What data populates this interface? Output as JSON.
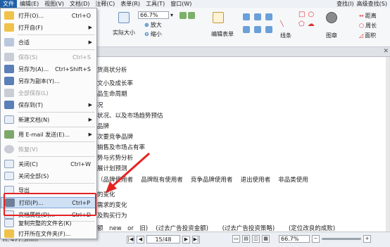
{
  "menubar": {
    "items": [
      "文件",
      "编辑(E)",
      "视图(V)",
      "文档(D)",
      "注释(C)",
      "表单(R)",
      "工具(T)",
      "窗口(W)"
    ],
    "right_items": [
      "查找(I)",
      "高级查找(S)"
    ]
  },
  "ribbon": {
    "zoom_value": "66.7%",
    "actual_size": "实际大小",
    "zoom_in": "放大",
    "zoom_out": "缩小",
    "edit_form": "编辑表单",
    "lines": "线条",
    "shapes": "图章",
    "distance": "距离",
    "perimeter": "周长",
    "area": "面积"
  },
  "doc": {
    "lines": [
      "货商状分析",
      "文小及成长率",
      "品生命周期",
      "况",
      "状况、以及市场趋势预估",
      "品牌",
      "次要竞争品牌",
      "销售及市场占有率",
      "势与劣势分析",
      "展计划预测",
      "（品牌使用者　 品牌既有使用者　 竞争品牌使用者　 退出使用者　 非品类使用",
      "的变化",
      "需求的变化",
      "及购买行为",
      "额　new　or　旧)　 (过去广告投资金额)　　 (过去广告投资策略)　　 (定位改良的成败)"
    ]
  },
  "file_menu": {
    "items": [
      {
        "label": "打开(O)...",
        "shortcut": "Ctrl+O",
        "arrow": "",
        "disabled": false
      },
      {
        "label": "打开自(F)",
        "shortcut": "",
        "arrow": "▶",
        "disabled": false
      },
      {
        "label": "合适",
        "shortcut": "",
        "arrow": "▶",
        "disabled": false
      },
      {
        "label": "保存(S)",
        "shortcut": "Ctrl+S",
        "arrow": "",
        "disabled": true
      },
      {
        "label": "另存为(A)...",
        "shortcut": "Ctrl+Shift+S",
        "arrow": "",
        "disabled": false
      },
      {
        "label": "另存为副本(Y)...",
        "shortcut": "",
        "arrow": "",
        "disabled": false
      },
      {
        "label": "全部保存(L)",
        "shortcut": "",
        "arrow": "",
        "disabled": true
      },
      {
        "label": "保存到(T)",
        "shortcut": "",
        "arrow": "▶",
        "disabled": false
      },
      {
        "label": "新建文档(N)",
        "shortcut": "",
        "arrow": "▶",
        "disabled": false
      },
      {
        "label": "用 E-mail 发送(E)...",
        "shortcut": "",
        "arrow": "▶",
        "disabled": false
      },
      {
        "label": "恢复(V)",
        "shortcut": "",
        "arrow": "",
        "disabled": true
      },
      {
        "label": "关闭(C)",
        "shortcut": "Ctrl+W",
        "arrow": "",
        "disabled": false
      },
      {
        "label": "关闭全部(S)",
        "shortcut": "",
        "arrow": "",
        "disabled": false
      },
      {
        "label": "导出",
        "shortcut": "",
        "arrow": "",
        "disabled": false
      },
      {
        "label": "打印(P)...",
        "shortcut": "Ctrl+P",
        "arrow": "",
        "disabled": false
      },
      {
        "label": "文档属性(D)...",
        "shortcut": "Ctrl+D",
        "arrow": "",
        "disabled": false
      },
      {
        "label": "复制完整的文件名(K)",
        "shortcut": "",
        "arrow": "",
        "disabled": false
      },
      {
        "label": "打开所在文件夹(F)...",
        "shortcut": "",
        "arrow": "",
        "disabled": false
      }
    ]
  },
  "status": {
    "size_text": "H: 477.3mm",
    "page_text": "15/48",
    "zoom_text": "66.7%"
  },
  "colors": {
    "highlight_box": "#e52222",
    "menu_highlight": "#cfe0f5"
  }
}
